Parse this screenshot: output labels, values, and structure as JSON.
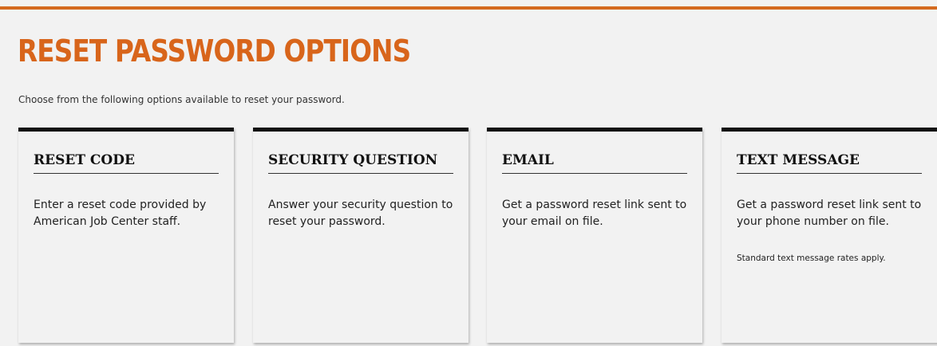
{
  "page": {
    "title": "RESET PASSWORD OPTIONS",
    "intro": "Choose from the following options available to reset your password."
  },
  "options": [
    {
      "title": "RESET CODE",
      "description": "Enter a reset code provided by American Job Center staff."
    },
    {
      "title": "SECURITY QUESTION",
      "description": "Answer your security question to reset your password."
    },
    {
      "title": "EMAIL",
      "description": "Get a password reset link sent to your email on file."
    },
    {
      "title": "TEXT MESSAGE",
      "description": "Get a password reset link sent to your phone number on file.",
      "note": "Standard text message rates apply."
    }
  ],
  "colors": {
    "accent": "#d8651b",
    "background": "#f2f2f2",
    "card_border": "#111111"
  }
}
